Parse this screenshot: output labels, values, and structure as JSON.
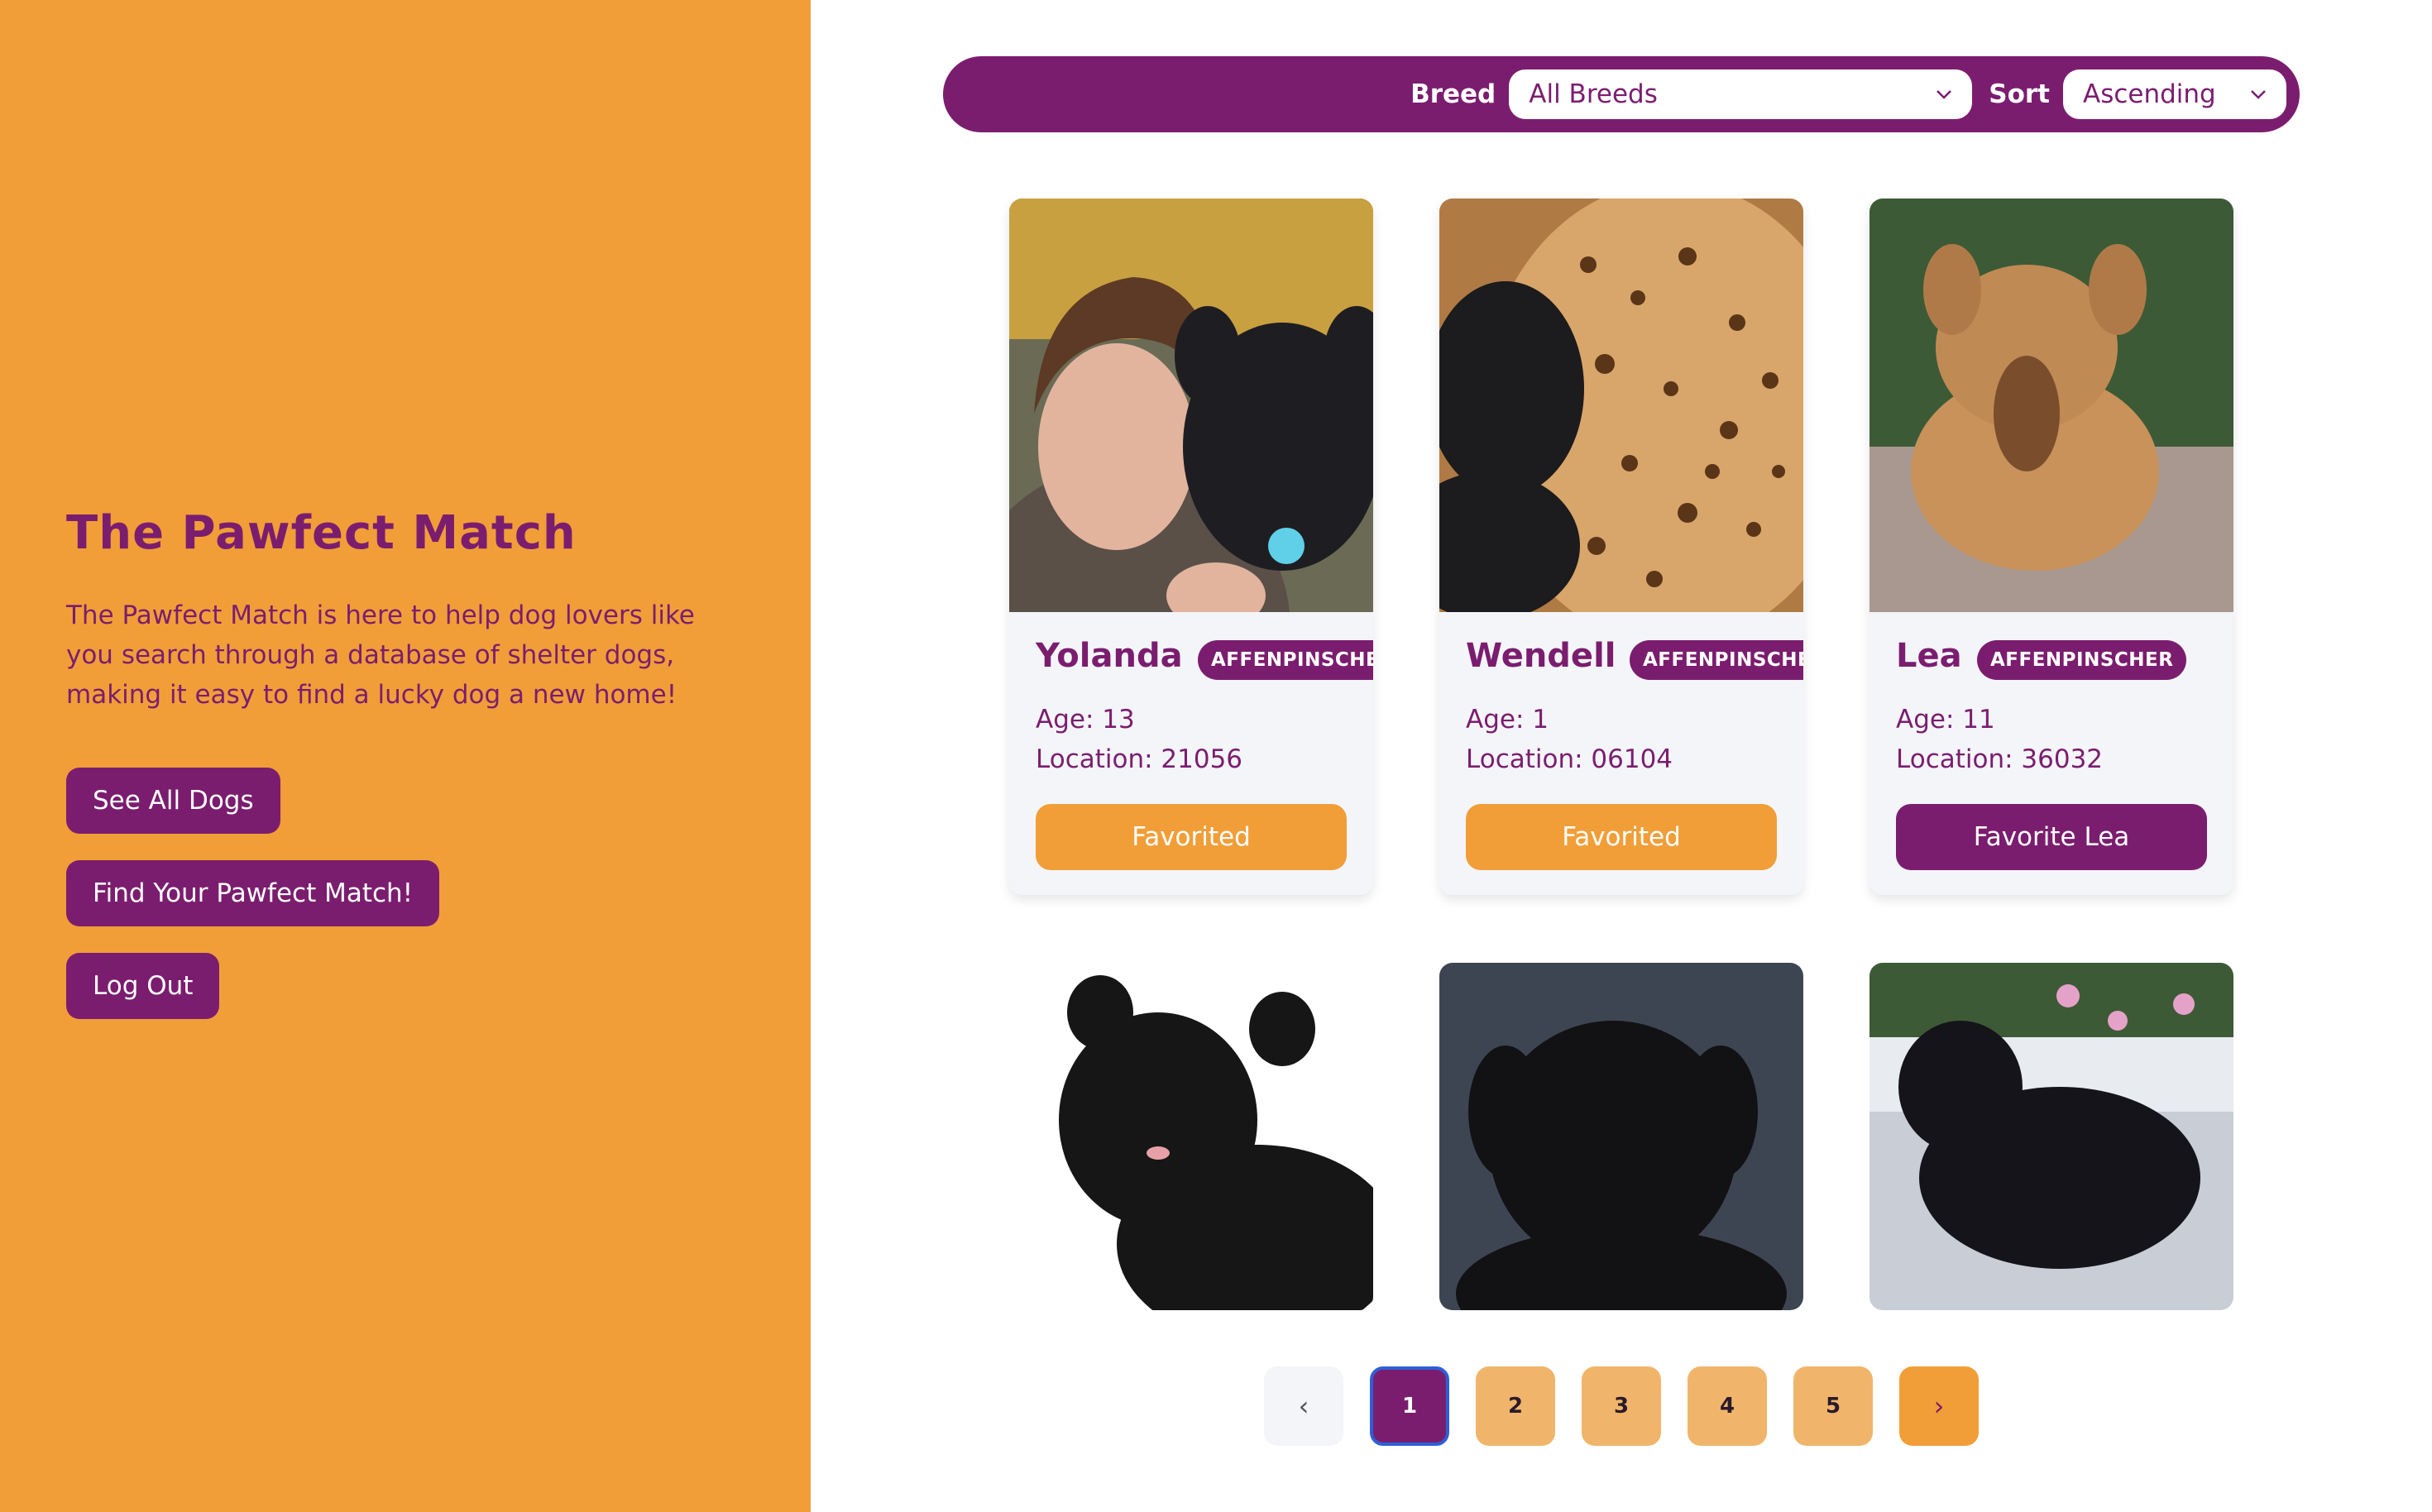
{
  "app": {
    "title": "The Pawfect Match",
    "description": "The Pawfect Match is here to help dog lovers like you search through a database of shelter dogs, making it easy to find a lucky dog a new home!"
  },
  "sidebar": {
    "buttons": [
      {
        "label": "See All Dogs"
      },
      {
        "label": "Find Your Pawfect Match!"
      },
      {
        "label": "Log Out"
      }
    ]
  },
  "filters": {
    "breed_label": "Breed",
    "breed_value": "All Breeds",
    "sort_label": "Sort",
    "sort_value": "Ascending"
  },
  "dogs": [
    {
      "name": "Yolanda",
      "breed": "AFFENPINSCHER",
      "age": "Age: 13",
      "location": "Location: 21056",
      "button": "Favorited",
      "favorited": true
    },
    {
      "name": "Wendell",
      "breed": "AFFENPINSCHER",
      "age": "Age: 1",
      "location": "Location: 06104",
      "button": "Favorited",
      "favorited": true
    },
    {
      "name": "Lea",
      "breed": "AFFENPINSCHER",
      "age": "Age: 11",
      "location": "Location: 36032",
      "button": "Favorite Lea",
      "favorited": false
    }
  ],
  "pagination": {
    "prev": "‹",
    "pages": [
      "1",
      "2",
      "3",
      "4",
      "5"
    ],
    "current": "1",
    "next": "›"
  },
  "colors": {
    "primary": "#7b1d6f",
    "accent": "#f19e38",
    "card_bg": "#f3f5f9"
  },
  "icons": {
    "select_caret": "chevron-down-icon",
    "prev": "chevron-left-icon",
    "next": "chevron-right-icon"
  }
}
